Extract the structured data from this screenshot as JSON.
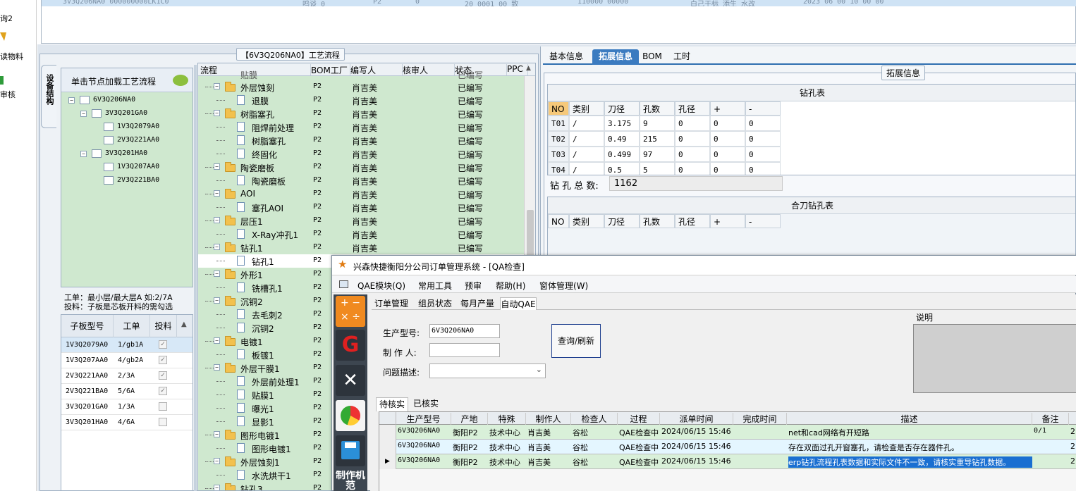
{
  "left_nav": {
    "items": [
      "询2",
      "读物料",
      "审核"
    ]
  },
  "top_row": {
    "cells": [
      "3V3Q206NA0 000000000LK1C0",
      "鸣谈 0",
      "P2",
      "0",
      "20 0001 00 致",
      "110000 00000",
      "白己于标 添生 水改",
      "2023 06 00 10 00 00"
    ]
  },
  "group_title": "【6V3Q206NA0】工艺流程",
  "side_tab": "设备结构",
  "tree_header": "单击节点加载工艺流程",
  "tree": [
    {
      "label": "6V3Q206NA0",
      "level": 0,
      "exp": "-"
    },
    {
      "label": "3V3Q201GA0",
      "level": 1,
      "exp": "-"
    },
    {
      "label": "1V3Q2079A0",
      "level": 2,
      "exp": ""
    },
    {
      "label": "2V3Q221AA0",
      "level": 2,
      "exp": ""
    },
    {
      "label": "3V3Q201HA0",
      "level": 1,
      "exp": "-"
    },
    {
      "label": "1V3Q207AA0",
      "level": 2,
      "exp": ""
    },
    {
      "label": "2V3Q221BA0",
      "level": 2,
      "exp": ""
    }
  ],
  "note": {
    "line1": "工单：最小层/最大层A 如:2/7A",
    "line2": "投料：子板是芯板开料的需勾选"
  },
  "sub_table": {
    "headers": [
      "子板型号",
      "工单",
      "投料"
    ],
    "rows": [
      {
        "model": "1V3Q2079A0",
        "order": "1/gb1A",
        "checked": true
      },
      {
        "model": "1V3Q207AA0",
        "order": "4/gb2A",
        "checked": true
      },
      {
        "model": "2V3Q221AA0",
        "order": "2/3A",
        "checked": true
      },
      {
        "model": "2V3Q221BA0",
        "order": "5/6A",
        "checked": true
      },
      {
        "model": "3V3Q201GA0",
        "order": "1/3A",
        "checked": false
      },
      {
        "model": "3V3Q201HA0",
        "order": "4/6A",
        "checked": false
      }
    ]
  },
  "flow": {
    "headers": [
      "流程",
      "BOM工厂",
      "编写人",
      "核审人",
      "状态",
      "PPC"
    ],
    "partial_top": [
      "贴膜",
      "已编写"
    ],
    "rows": [
      {
        "name": "外层蚀刻",
        "level": 0,
        "bom": "P2",
        "writer": "肖吉美",
        "reviewer": "",
        "status": "已编写"
      },
      {
        "name": "退膜",
        "level": 1,
        "bom": "P2",
        "writer": "肖吉美",
        "reviewer": "",
        "status": "已编写"
      },
      {
        "name": "树脂塞孔",
        "level": 0,
        "bom": "P2",
        "writer": "肖吉美",
        "reviewer": "",
        "status": "已编写"
      },
      {
        "name": "阻焊前处理",
        "level": 1,
        "bom": "P2",
        "writer": "肖吉美",
        "reviewer": "",
        "status": "已编写"
      },
      {
        "name": "树脂塞孔",
        "level": 1,
        "bom": "P2",
        "writer": "肖吉美",
        "reviewer": "",
        "status": "已编写"
      },
      {
        "name": "终固化",
        "level": 1,
        "bom": "P2",
        "writer": "肖吉美",
        "reviewer": "",
        "status": "已编写"
      },
      {
        "name": "陶瓷磨板",
        "level": 0,
        "bom": "P2",
        "writer": "肖吉美",
        "reviewer": "",
        "status": "已编写"
      },
      {
        "name": "陶瓷磨板",
        "level": 1,
        "bom": "P2",
        "writer": "肖吉美",
        "reviewer": "",
        "status": "已编写"
      },
      {
        "name": "AOI",
        "level": 0,
        "bom": "P2",
        "writer": "肖吉美",
        "reviewer": "",
        "status": "已编写"
      },
      {
        "name": "塞孔AOI",
        "level": 1,
        "bom": "P2",
        "writer": "肖吉美",
        "reviewer": "",
        "status": "已编写"
      },
      {
        "name": "层压1",
        "level": 0,
        "bom": "P2",
        "writer": "肖吉美",
        "reviewer": "",
        "status": "已编写"
      },
      {
        "name": "X-Ray冲孔1",
        "level": 1,
        "bom": "P2",
        "writer": "肖吉美",
        "reviewer": "",
        "status": "已编写"
      },
      {
        "name": "钻孔1",
        "level": 0,
        "bom": "P2",
        "writer": "肖吉美",
        "reviewer": "",
        "status": "已编写"
      },
      {
        "name": "钻孔1",
        "level": 1,
        "bom": "P2",
        "writer": "",
        "reviewer": "",
        "status": "",
        "selected": true
      },
      {
        "name": "外形1",
        "level": 0,
        "bom": "P2",
        "writer": "",
        "reviewer": "",
        "status": ""
      },
      {
        "name": "铣槽孔1",
        "level": 1,
        "bom": "P2",
        "writer": "",
        "reviewer": "",
        "status": ""
      },
      {
        "name": "沉铜2",
        "level": 0,
        "bom": "P2",
        "writer": "",
        "reviewer": "",
        "status": ""
      },
      {
        "name": "去毛刺2",
        "level": 1,
        "bom": "P2",
        "writer": "",
        "reviewer": "",
        "status": ""
      },
      {
        "name": "沉铜2",
        "level": 1,
        "bom": "P2",
        "writer": "",
        "reviewer": "",
        "status": ""
      },
      {
        "name": "电镀1",
        "level": 0,
        "bom": "P2",
        "writer": "",
        "reviewer": "",
        "status": ""
      },
      {
        "name": "板镀1",
        "level": 1,
        "bom": "P2",
        "writer": "",
        "reviewer": "",
        "status": ""
      },
      {
        "name": "外层干膜1",
        "level": 0,
        "bom": "P2",
        "writer": "",
        "reviewer": "",
        "status": ""
      },
      {
        "name": "外层前处理1",
        "level": 1,
        "bom": "P2",
        "writer": "",
        "reviewer": "",
        "status": ""
      },
      {
        "name": "贴膜1",
        "level": 1,
        "bom": "P2",
        "writer": "",
        "reviewer": "",
        "status": ""
      },
      {
        "name": "曝光1",
        "level": 1,
        "bom": "P2",
        "writer": "",
        "reviewer": "",
        "status": ""
      },
      {
        "name": "显影1",
        "level": 1,
        "bom": "P2",
        "writer": "",
        "reviewer": "",
        "status": ""
      },
      {
        "name": "图形电镀1",
        "level": 0,
        "bom": "P2",
        "writer": "",
        "reviewer": "",
        "status": ""
      },
      {
        "name": "图形电镀1",
        "level": 1,
        "bom": "P2",
        "writer": "",
        "reviewer": "",
        "status": ""
      },
      {
        "name": "外层蚀刻1",
        "level": 0,
        "bom": "P2",
        "writer": "",
        "reviewer": "",
        "status": ""
      },
      {
        "name": "水洗烘干1",
        "level": 1,
        "bom": "P2",
        "writer": "",
        "reviewer": "",
        "status": ""
      },
      {
        "name": "钻孔3",
        "level": 0,
        "bom": "P2",
        "writer": "",
        "reviewer": "",
        "status": ""
      }
    ]
  },
  "right_tabs": [
    "基本信息",
    "拓展信息",
    "BOM",
    "工时"
  ],
  "ext_title": "拓展信息",
  "drill": {
    "title": "钻孔表",
    "headers": [
      "NO",
      "类别",
      "刀径",
      "孔数",
      "孔径",
      "+",
      "-"
    ],
    "rows": [
      [
        "T01",
        "/",
        "3.175",
        "9",
        "0",
        "0",
        "0"
      ],
      [
        "T02",
        "/",
        "0.49",
        "215",
        "0",
        "0",
        "0"
      ],
      [
        "T03",
        "/",
        "0.499",
        "97",
        "0",
        "0",
        "0"
      ],
      [
        "T04",
        "/",
        "0.5",
        "5",
        "0",
        "0",
        "0"
      ]
    ],
    "total_label": "钻 孔 总 数:",
    "total_value": "1162"
  },
  "merge": {
    "title": "合刀钻孔表",
    "headers": [
      "NO",
      "类别",
      "刀径",
      "孔数",
      "孔径",
      "+",
      "-"
    ]
  },
  "qa": {
    "title": "兴森快捷衡阳分公司订单管理系统 - [QA检查]",
    "menu": [
      "QAE模块(Q)",
      "常用工具",
      "预审",
      "帮助(H)",
      "窗体管理(W)"
    ],
    "tabs": [
      "订单管理",
      "组员状态",
      "每月产量",
      "自动QAE"
    ],
    "form": {
      "model_label": "生产型号:",
      "model_value": "6V3Q206NA0",
      "maker_label": "制 作 人:",
      "maker_value": "",
      "issue_label": "问题描述:",
      "issue_value": "",
      "query_btn": "查询/刷新",
      "desc_label": "说明"
    },
    "sub_tabs": [
      "待核实",
      "已核实"
    ],
    "grid": {
      "headers": [
        "生产型号",
        "产地",
        "特殊",
        "制作人",
        "检查人",
        "过程",
        "派单时间",
        "完成时间",
        "描述",
        "备注"
      ],
      "rows": [
        {
          "model": "6V3Q206NA0",
          "place": "衡阳P2",
          "special": "技术中心",
          "maker": "肖吉美",
          "checker": "谷松",
          "process": "QAE检查中",
          "dispatch": "2024/06/15 15:46",
          "done": "",
          "desc": "net和cad网络有开短路",
          "remark": "0/1",
          "extra": "2"
        },
        {
          "model": "6V3Q206NA0",
          "place": "衡阳P2",
          "special": "技术中心",
          "maker": "肖吉美",
          "checker": "谷松",
          "process": "QAE检查中",
          "dispatch": "2024/06/15 15:46",
          "done": "",
          "desc": "存在双面过孔开窗塞孔，请检查是否存在器件孔。",
          "remark": "",
          "extra": "2"
        },
        {
          "model": "6V3Q206NA0",
          "place": "衡阳P2",
          "special": "技术中心",
          "maker": "肖吉美",
          "checker": "谷松",
          "process": "QAE检查中",
          "dispatch": "2024/06/15 15:46",
          "done": "",
          "desc": "erp钻孔流程孔表数据和实际文件不一致，请核实重导钻孔数据。",
          "remark": "",
          "extra": "2"
        }
      ]
    },
    "toolbar_bottom_label": "制作机范"
  }
}
